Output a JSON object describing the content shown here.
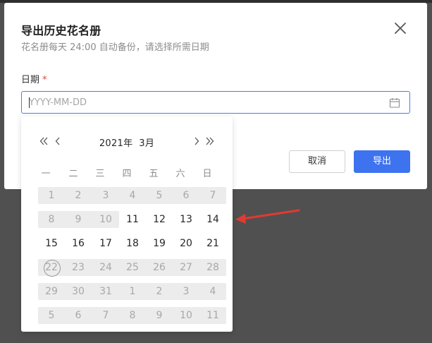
{
  "dialog": {
    "title": "导出历史花名册",
    "subtitle": "花名册每天 24:00 自动备份，请选择所需日期",
    "field_label": "日期",
    "required_mark": "*",
    "date_input": {
      "value": "",
      "placeholder": "YYYY-MM-DD"
    },
    "cancel_label": "取消",
    "export_label": "导出",
    "icons": {
      "close": "close-icon",
      "calendar": "calendar-icon"
    }
  },
  "picker": {
    "year_label": "2021年",
    "month_label": "3月",
    "icons": {
      "prev_year": "double-chevron-left-icon",
      "prev_month": "chevron-left-icon",
      "next_month": "chevron-right-icon",
      "next_year": "double-chevron-right-icon"
    },
    "weekdays": [
      "一",
      "二",
      "三",
      "四",
      "五",
      "六",
      "日"
    ],
    "weeks": [
      [
        {
          "label": "1",
          "disabled": true
        },
        {
          "label": "2",
          "disabled": true
        },
        {
          "label": "3",
          "disabled": true
        },
        {
          "label": "4",
          "disabled": true
        },
        {
          "label": "5",
          "disabled": true
        },
        {
          "label": "6",
          "disabled": true
        },
        {
          "label": "7",
          "disabled": true
        }
      ],
      [
        {
          "label": "8",
          "disabled": true
        },
        {
          "label": "9",
          "disabled": true
        },
        {
          "label": "10",
          "disabled": true
        },
        {
          "label": "11",
          "disabled": false
        },
        {
          "label": "12",
          "disabled": false
        },
        {
          "label": "13",
          "disabled": false
        },
        {
          "label": "14",
          "disabled": false
        }
      ],
      [
        {
          "label": "15",
          "disabled": false
        },
        {
          "label": "16",
          "disabled": false
        },
        {
          "label": "17",
          "disabled": false
        },
        {
          "label": "18",
          "disabled": false
        },
        {
          "label": "19",
          "disabled": false
        },
        {
          "label": "20",
          "disabled": false
        },
        {
          "label": "21",
          "disabled": false
        }
      ],
      [
        {
          "label": "22",
          "disabled": true,
          "today": true
        },
        {
          "label": "23",
          "disabled": true
        },
        {
          "label": "24",
          "disabled": true
        },
        {
          "label": "25",
          "disabled": true
        },
        {
          "label": "26",
          "disabled": true
        },
        {
          "label": "27",
          "disabled": true
        },
        {
          "label": "28",
          "disabled": true
        }
      ],
      [
        {
          "label": "29",
          "disabled": true
        },
        {
          "label": "30",
          "disabled": true
        },
        {
          "label": "31",
          "disabled": true
        },
        {
          "label": "1",
          "disabled": true
        },
        {
          "label": "2",
          "disabled": true
        },
        {
          "label": "3",
          "disabled": true
        },
        {
          "label": "4",
          "disabled": true
        }
      ],
      [
        {
          "label": "5",
          "disabled": true
        },
        {
          "label": "6",
          "disabled": true
        },
        {
          "label": "7",
          "disabled": true
        },
        {
          "label": "8",
          "disabled": true
        },
        {
          "label": "9",
          "disabled": true
        },
        {
          "label": "10",
          "disabled": true
        },
        {
          "label": "11",
          "disabled": true
        }
      ]
    ]
  },
  "annotation": {
    "arrow_color": "#e03a32"
  },
  "colors": {
    "accent": "#3e73f0",
    "required": "#e8453c",
    "disabled_text": "#a8a8a8",
    "disabled_bg": "#ececec",
    "backdrop": "#505050"
  }
}
